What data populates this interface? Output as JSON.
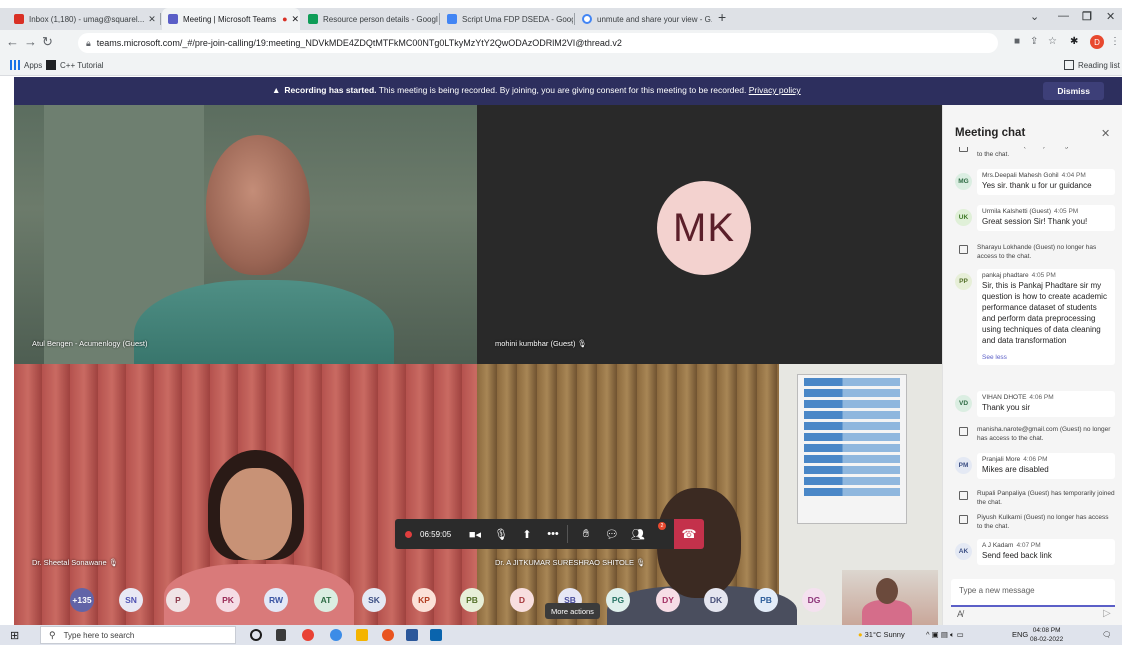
{
  "browser": {
    "tabs": [
      {
        "title": "Inbox (1,180) - umag@squarel...",
        "favicon_color": "#d93025",
        "active": false
      },
      {
        "title": "Meeting | Microsoft Teams",
        "favicon_color": "#5b5fc7",
        "active": true
      },
      {
        "title": "Resource person details - Googl...",
        "favicon_color": "#0f9d58",
        "active": false
      },
      {
        "title": "Script Uma FDP DSEDA - Googl...",
        "favicon_color": "#4285f4",
        "active": false
      },
      {
        "title": "unmute and share your view - G...",
        "favicon_color": "#4285f4",
        "active": false
      }
    ],
    "new_tab_icon": "plus-icon",
    "url": "teams.microsoft.com/_#/pre-join-calling/19:meeting_NDVkMDE4ZDQtMTFkMC00NTg0LTkyMzYtY2QwODAzODRlM2VI@thread.v2",
    "bookmarks": [
      {
        "label": "Apps",
        "icon": "apps-grid-icon"
      },
      {
        "label": "C++ Tutorial",
        "icon": "bookmark-favicon-icon"
      }
    ],
    "reading_list": "Reading list",
    "profile_initial": "D"
  },
  "banner": {
    "bold": "Recording has started.",
    "text": " This meeting is being recorded. By joining, you are giving consent for this meeting to be recorded. ",
    "link": "Privacy policy",
    "dismiss": "Dismiss"
  },
  "tiles": {
    "t1_name": "Atul Bengen - Acumenlogy (Guest)",
    "t2_name": "mohini kumbhar (Guest)",
    "t2_initials": "MK",
    "t3_name": "Dr. Sheetal Sonawane",
    "t4_name": "Dr. A JITKUMAR SURESHRAO SHITOLE"
  },
  "participants": [
    {
      "label": "+135",
      "bg": "#6264a7",
      "fg": "#ffffff"
    },
    {
      "label": "SN",
      "bg": "#e8e8f4",
      "fg": "#4f52b2"
    },
    {
      "label": "P",
      "bg": "#f0e4e6",
      "fg": "#8b3a4a"
    },
    {
      "label": "PK",
      "bg": "#f5dce5",
      "fg": "#9b2c58"
    },
    {
      "label": "RW",
      "bg": "#e3e8f7",
      "fg": "#3b55a4"
    },
    {
      "label": "AT",
      "bg": "#dbeee2",
      "fg": "#2d6b43"
    },
    {
      "label": "SK",
      "bg": "#e4e9f4",
      "fg": "#3c4f84"
    },
    {
      "label": "KP",
      "bg": "#fbe1d8",
      "fg": "#b13e22"
    },
    {
      "label": "PB",
      "bg": "#e7efd8",
      "fg": "#54702a"
    },
    {
      "label": "D",
      "bg": "#f8dfdf",
      "fg": "#a5373b"
    },
    {
      "label": "SB",
      "bg": "#e6e7f5",
      "fg": "#484c9b"
    },
    {
      "label": "PG",
      "bg": "#dff0ec",
      "fg": "#2a7566"
    },
    {
      "label": "DY",
      "bg": "#f7dde6",
      "fg": "#a23063"
    },
    {
      "label": "DK",
      "bg": "#e5e6f0",
      "fg": "#48507a"
    },
    {
      "label": "PB",
      "bg": "#e3ecf8",
      "fg": "#2f5f9c"
    },
    {
      "label": "DG",
      "bg": "#f4e1ef",
      "fg": "#8c3479"
    }
  ],
  "controls": {
    "timer": "06:59:05",
    "tooltip": "More actions",
    "people_badge": "2"
  },
  "chat": {
    "title": "Meeting chat",
    "compose_placeholder": "Type a new message",
    "items": [
      {
        "kind": "sys",
        "text": "Vaidai Gaikwad (Guest) no longer has access to the chat."
      },
      {
        "kind": "msg",
        "initials": "MG",
        "name": "Mrs.Deepali Mahesh Gohil",
        "time": "4:04 PM",
        "text": "Yes sir. thank u for ur guidance",
        "bg": "#dbeee2",
        "fg": "#2d6b43"
      },
      {
        "kind": "msg",
        "initials": "UK",
        "name": "Urmila Kalshetti (Guest)",
        "time": "4:05 PM",
        "text": "Great session Sir! Thank you!",
        "bg": "#e0f0d8",
        "fg": "#3f7a28"
      },
      {
        "kind": "sys",
        "text": "Sharayu Lokhande (Guest) no longer has access to the chat."
      },
      {
        "kind": "msg",
        "initials": "PP",
        "name": "pankaj phadtare",
        "time": "4:05 PM",
        "text": "Sir, this is Pankaj Phadtare sir my question is how to create academic performance dataset of students and perform data preprocessing using techniques of data cleaning and data transformation",
        "more": "See less",
        "bg": "#e7efd8",
        "fg": "#54702a"
      },
      {
        "kind": "msg",
        "initials": "VD",
        "name": "VIHAN DHOTE",
        "time": "4:06 PM",
        "text": "Thank you sir",
        "bg": "#dbeee2",
        "fg": "#2d6b43"
      },
      {
        "kind": "sys",
        "text": "manisha.narote@gmail.com (Guest) no longer has access to the chat."
      },
      {
        "kind": "msg",
        "initials": "PM",
        "name": "Pranjali More",
        "time": "4:06 PM",
        "text": "Mikes are disabled",
        "bg": "#e4e9f4",
        "fg": "#3c4f84"
      },
      {
        "kind": "sys",
        "text": "Rupali Panpaliya (Guest) has temporarily joined the chat."
      },
      {
        "kind": "sys",
        "text": "Piyush Kulkarni (Guest) no longer has access to the chat."
      },
      {
        "kind": "msg",
        "initials": "AK",
        "name": "A J Kadam",
        "time": "4:07 PM",
        "text": "Send feed back link",
        "bg": "#e4e9f4",
        "fg": "#3c4f84"
      }
    ]
  },
  "taskbar": {
    "search_placeholder": "Type here to search",
    "weather": "31°C  Sunny",
    "lang": "ENG",
    "time": "04:08 PM",
    "date": "08-02-2022"
  }
}
